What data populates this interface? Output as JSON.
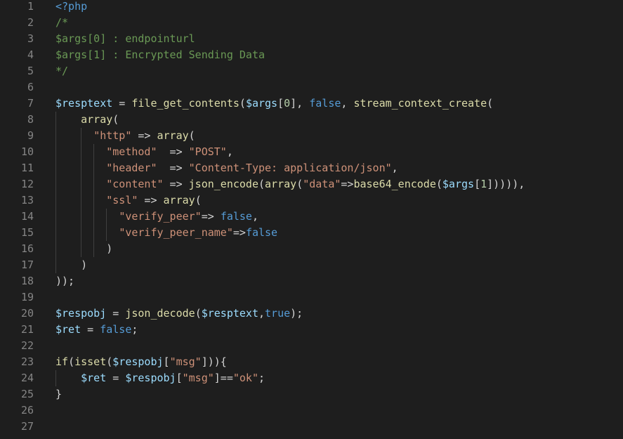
{
  "editor": {
    "language": "php",
    "theme_colors": {
      "background": "#1e1e1e",
      "line_number": "#858585",
      "plain": "#d4d4d4",
      "variable": "#9cdcfe",
      "function": "#dcdcaa",
      "string": "#ce9178",
      "keyword": "#569cd6",
      "comment": "#6a9955",
      "number": "#b5cea8"
    },
    "lines": [
      {
        "n": "1",
        "tokens": [
          {
            "t": "kw",
            "v": "<?php"
          }
        ]
      },
      {
        "n": "2",
        "tokens": [
          {
            "t": "com",
            "v": "/*"
          }
        ]
      },
      {
        "n": "3",
        "tokens": [
          {
            "t": "com",
            "v": "$args[0] : endpointurl"
          }
        ]
      },
      {
        "n": "4",
        "tokens": [
          {
            "t": "com",
            "v": "$args[1] : Encrypted Sending Data"
          }
        ]
      },
      {
        "n": "5",
        "tokens": [
          {
            "t": "com",
            "v": "*/"
          }
        ]
      },
      {
        "n": "6",
        "tokens": []
      },
      {
        "n": "7",
        "tokens": [
          {
            "t": "var",
            "v": "$resptext"
          },
          {
            "t": "plain",
            "v": " = "
          },
          {
            "t": "fn",
            "v": "file_get_contents"
          },
          {
            "t": "plain",
            "v": "("
          },
          {
            "t": "var",
            "v": "$args"
          },
          {
            "t": "plain",
            "v": "["
          },
          {
            "t": "num",
            "v": "0"
          },
          {
            "t": "plain",
            "v": "], "
          },
          {
            "t": "kw",
            "v": "false"
          },
          {
            "t": "plain",
            "v": ", "
          },
          {
            "t": "fn",
            "v": "stream_context_create"
          },
          {
            "t": "plain",
            "v": "("
          }
        ]
      },
      {
        "n": "8",
        "tokens": [
          {
            "t": "plain",
            "v": "    "
          },
          {
            "t": "fn",
            "v": "array"
          },
          {
            "t": "plain",
            "v": "("
          }
        ]
      },
      {
        "n": "9",
        "tokens": [
          {
            "t": "plain",
            "v": "      "
          },
          {
            "t": "str",
            "v": "\"http\""
          },
          {
            "t": "plain",
            "v": " => "
          },
          {
            "t": "fn",
            "v": "array"
          },
          {
            "t": "plain",
            "v": "("
          }
        ]
      },
      {
        "n": "10",
        "tokens": [
          {
            "t": "plain",
            "v": "        "
          },
          {
            "t": "str",
            "v": "\"method\""
          },
          {
            "t": "plain",
            "v": "  => "
          },
          {
            "t": "str",
            "v": "\"POST\""
          },
          {
            "t": "plain",
            "v": ","
          }
        ]
      },
      {
        "n": "11",
        "tokens": [
          {
            "t": "plain",
            "v": "        "
          },
          {
            "t": "str",
            "v": "\"header\""
          },
          {
            "t": "plain",
            "v": "  => "
          },
          {
            "t": "str",
            "v": "\"Content-Type: application/json\""
          },
          {
            "t": "plain",
            "v": ","
          }
        ]
      },
      {
        "n": "12",
        "tokens": [
          {
            "t": "plain",
            "v": "        "
          },
          {
            "t": "str",
            "v": "\"content\""
          },
          {
            "t": "plain",
            "v": " => "
          },
          {
            "t": "fn",
            "v": "json_encode"
          },
          {
            "t": "plain",
            "v": "("
          },
          {
            "t": "fn",
            "v": "array"
          },
          {
            "t": "plain",
            "v": "("
          },
          {
            "t": "str",
            "v": "\"data\""
          },
          {
            "t": "plain",
            "v": "=>"
          },
          {
            "t": "fn",
            "v": "base64_encode"
          },
          {
            "t": "plain",
            "v": "("
          },
          {
            "t": "var",
            "v": "$args"
          },
          {
            "t": "plain",
            "v": "["
          },
          {
            "t": "num",
            "v": "1"
          },
          {
            "t": "plain",
            "v": "])))),"
          }
        ]
      },
      {
        "n": "13",
        "tokens": [
          {
            "t": "plain",
            "v": "        "
          },
          {
            "t": "str",
            "v": "\"ssl\""
          },
          {
            "t": "plain",
            "v": " => "
          },
          {
            "t": "fn",
            "v": "array"
          },
          {
            "t": "plain",
            "v": "("
          }
        ]
      },
      {
        "n": "14",
        "tokens": [
          {
            "t": "plain",
            "v": "          "
          },
          {
            "t": "str",
            "v": "\"verify_peer\""
          },
          {
            "t": "plain",
            "v": "=> "
          },
          {
            "t": "kw",
            "v": "false"
          },
          {
            "t": "plain",
            "v": ","
          }
        ]
      },
      {
        "n": "15",
        "tokens": [
          {
            "t": "plain",
            "v": "          "
          },
          {
            "t": "str",
            "v": "\"verify_peer_name\""
          },
          {
            "t": "plain",
            "v": "=>"
          },
          {
            "t": "kw",
            "v": "false"
          }
        ]
      },
      {
        "n": "16",
        "tokens": [
          {
            "t": "plain",
            "v": "        )"
          }
        ]
      },
      {
        "n": "17",
        "tokens": [
          {
            "t": "plain",
            "v": "    )"
          }
        ]
      },
      {
        "n": "18",
        "tokens": [
          {
            "t": "plain",
            "v": "));"
          }
        ]
      },
      {
        "n": "19",
        "tokens": []
      },
      {
        "n": "20",
        "tokens": [
          {
            "t": "var",
            "v": "$respobj"
          },
          {
            "t": "plain",
            "v": " = "
          },
          {
            "t": "fn",
            "v": "json_decode"
          },
          {
            "t": "plain",
            "v": "("
          },
          {
            "t": "var",
            "v": "$resptext"
          },
          {
            "t": "plain",
            "v": ","
          },
          {
            "t": "kw",
            "v": "true"
          },
          {
            "t": "plain",
            "v": ");"
          }
        ]
      },
      {
        "n": "21",
        "tokens": [
          {
            "t": "var",
            "v": "$ret"
          },
          {
            "t": "plain",
            "v": " = "
          },
          {
            "t": "kw",
            "v": "false"
          },
          {
            "t": "plain",
            "v": ";"
          }
        ]
      },
      {
        "n": "22",
        "tokens": []
      },
      {
        "n": "23",
        "tokens": [
          {
            "t": "fn",
            "v": "if"
          },
          {
            "t": "plain",
            "v": "("
          },
          {
            "t": "fn",
            "v": "isset"
          },
          {
            "t": "plain",
            "v": "("
          },
          {
            "t": "var",
            "v": "$respobj"
          },
          {
            "t": "plain",
            "v": "["
          },
          {
            "t": "str",
            "v": "\"msg\""
          },
          {
            "t": "plain",
            "v": "])){"
          }
        ]
      },
      {
        "n": "24",
        "tokens": [
          {
            "t": "plain",
            "v": "    "
          },
          {
            "t": "var",
            "v": "$ret"
          },
          {
            "t": "plain",
            "v": " = "
          },
          {
            "t": "var",
            "v": "$respobj"
          },
          {
            "t": "plain",
            "v": "["
          },
          {
            "t": "str",
            "v": "\"msg\""
          },
          {
            "t": "plain",
            "v": "]=="
          },
          {
            "t": "str",
            "v": "\"ok\""
          },
          {
            "t": "plain",
            "v": ";"
          }
        ]
      },
      {
        "n": "25",
        "tokens": [
          {
            "t": "plain",
            "v": "}"
          }
        ]
      },
      {
        "n": "26",
        "tokens": []
      },
      {
        "n": "27",
        "tokens": []
      }
    ]
  }
}
